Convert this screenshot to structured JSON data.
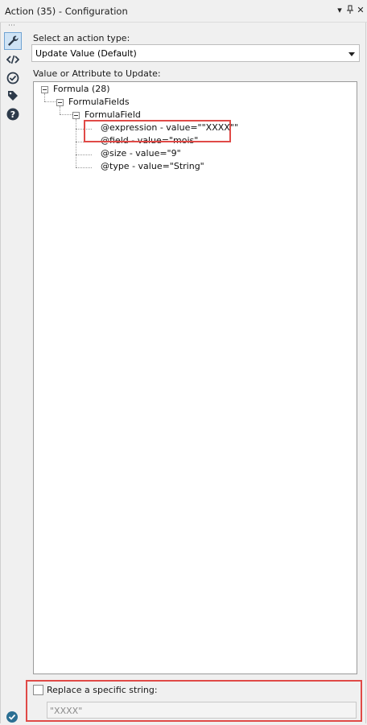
{
  "window": {
    "title": "Action (35) - Configuration",
    "dropdown_glyph": "▾",
    "pin_glyph": "📌",
    "close_glyph": "✕"
  },
  "toolbar": {
    "grip": "⋯",
    "tools": [
      {
        "name": "configuration-wrench-icon",
        "active": true
      },
      {
        "name": "xml-view-icon",
        "active": false
      },
      {
        "name": "connection-icon",
        "active": false
      },
      {
        "name": "annotation-tag-icon",
        "active": false
      },
      {
        "name": "help-icon",
        "active": false
      }
    ]
  },
  "config": {
    "action_type_label": "Select an action type:",
    "action_type_value": "Update Value (Default)",
    "tree_label": "Value or Attribute to Update:"
  },
  "tree": {
    "nodes": [
      {
        "text": "Formula (28)"
      },
      {
        "text": "FormulaFields"
      },
      {
        "text": "FormulaField"
      },
      {
        "text": "@expression - value=\"\"XXXX\"\""
      },
      {
        "text": "@field - value=\"mois\""
      },
      {
        "text": "@size - value=\"9\""
      },
      {
        "text": "@type - value=\"String\""
      }
    ]
  },
  "replace": {
    "label": "Replace a specific string:",
    "checked": false,
    "value": "\"XXXX\""
  },
  "status": {
    "icon": "ok-check-icon"
  },
  "colors": {
    "highlight": "#e04a47",
    "accent": "#2b6f93"
  }
}
